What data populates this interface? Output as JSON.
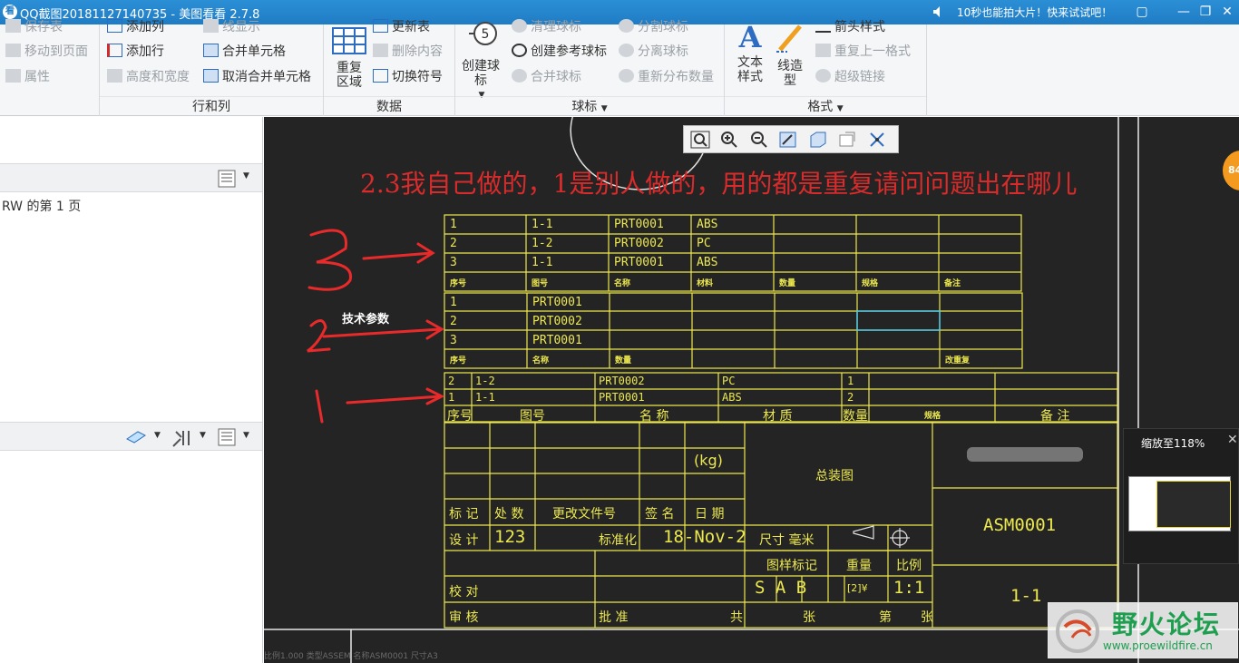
{
  "titlebar": {
    "title": "QQ截图20181127140735 - 美图看看 2.7.8",
    "promo": "10秒也能拍大片！快来试试吧！",
    "min": "—",
    "restore": "❐",
    "close": "✕"
  },
  "ribbon": {
    "col1": [
      "保存表",
      "移动到页面",
      "属性"
    ],
    "col2": [
      "添加列",
      "添加行",
      "高度和宽度"
    ],
    "col3": [
      "线显示",
      "合并单元格",
      "取消合并单元格"
    ],
    "group_rows_cols": "行和列",
    "repeat_region": "重复区域",
    "data_col": [
      "更新表",
      "删除内容",
      "切换符号"
    ],
    "group_data": "数据",
    "create_balloon": "创建球标",
    "balloon_col1": [
      "清理球标",
      "创建参考球标",
      "合并球标"
    ],
    "balloon_col2": [
      "分割球标",
      "分离球标",
      "重新分布数量"
    ],
    "group_balloon": "球标",
    "text_style": "文本样式",
    "line_style": "线造型",
    "format_col": [
      "箭头样式",
      "重复上一格式",
      "超级链接"
    ],
    "group_format": "格式"
  },
  "leftpanel": {
    "page_text": "RW 的第 1 页"
  },
  "canvas": {
    "question": "2.3我自己做的，1是别人做的，用的都是重复请问问题出在哪儿",
    "note_tech": "技术参数",
    "table3": {
      "rows": [
        [
          "1",
          "1-1",
          "PRT0001",
          "ABS"
        ],
        [
          "2",
          "1-2",
          "PRT0002",
          "PC"
        ],
        [
          "3",
          "1-1",
          "PRT0001",
          "ABS"
        ]
      ],
      "headers": [
        "序号",
        "图号",
        "名称",
        "材料",
        "数量",
        "规格",
        "备注"
      ]
    },
    "table2": {
      "rows": [
        [
          "1",
          "PRT0001"
        ],
        [
          "2",
          "PRT0002"
        ],
        [
          "3",
          "PRT0001"
        ]
      ],
      "headers": [
        "序号",
        "名称",
        "数量",
        "改重复"
      ]
    },
    "table1": {
      "rows": [
        [
          "2",
          "1-2",
          "PRT0002",
          "PC",
          "1"
        ],
        [
          "1",
          "1-1",
          "PRT0001",
          "ABS",
          "2"
        ]
      ],
      "headers": [
        "序号",
        "图号",
        "名 称",
        "材 质",
        "数量",
        "规格",
        "备 注"
      ]
    },
    "titleblock": {
      "kg": "(kg)",
      "assembly": "总装图",
      "part": "ASM0001",
      "marks": "标 记",
      "count": "处 数",
      "change_doc": "更改文件号",
      "sign": "签 名",
      "date_lbl": "日 期",
      "design": "设 计",
      "design_val": "123",
      "standard": "标准化",
      "date_val": "18-Nov-2",
      "size_unit": "尺寸 毫米",
      "sample_mark": "图样标记",
      "weight": "重量",
      "scale": "比例",
      "sab": "S  A  B",
      "weight_val": "[2]¥",
      "scale_val": "1:1",
      "check": "校 对",
      "review": "审 核",
      "approve": "批 准",
      "total": "共",
      "sheets": "张",
      "sheet_no": "第",
      "sheets2": "张",
      "sheet_val": "1-1"
    },
    "status": "比例1.000    类型ASSEM    名称ASM0001    尺寸A3"
  },
  "zoom": {
    "label": "缩放至118%",
    "close": "✕"
  },
  "watermark": {
    "title": "野火论坛",
    "url": "www.proewildfire.cn"
  },
  "badge": "84"
}
